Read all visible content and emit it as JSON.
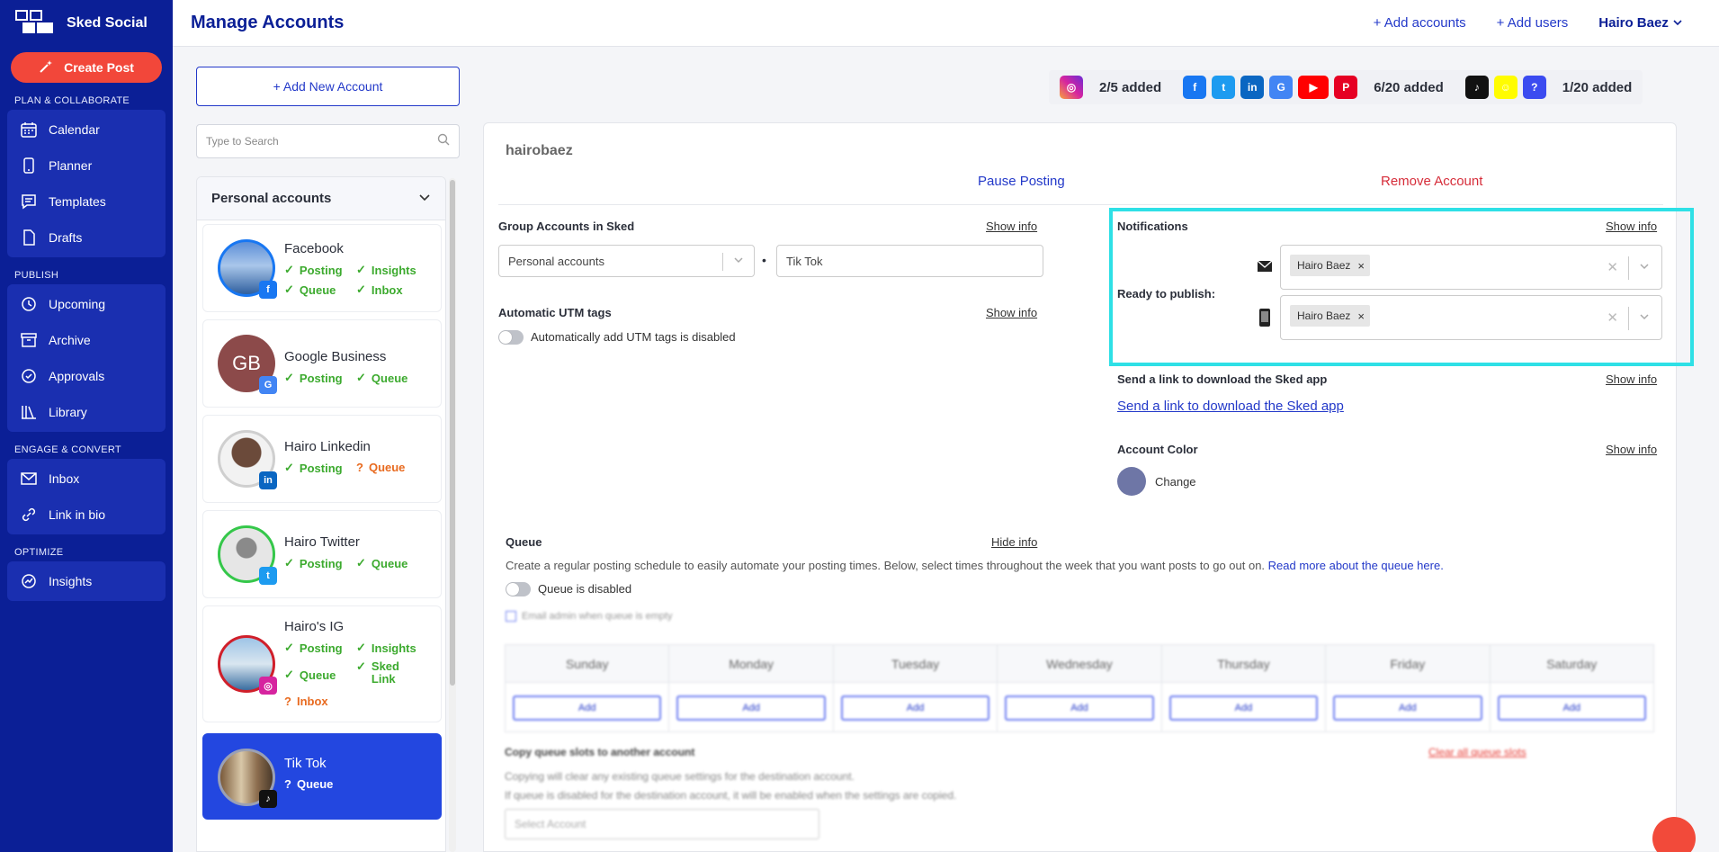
{
  "brand": {
    "name": "Sked Social",
    "logo_text": "SOCIAL"
  },
  "sidebar": {
    "create_post": "Create Post",
    "sections": [
      {
        "title": "PLAN & COLLABORATE",
        "items": [
          "Calendar",
          "Planner",
          "Templates",
          "Drafts"
        ]
      },
      {
        "title": "PUBLISH",
        "items": [
          "Upcoming",
          "Archive",
          "Approvals",
          "Library"
        ]
      },
      {
        "title": "ENGAGE & CONVERT",
        "items": [
          "Inbox",
          "Link in bio"
        ]
      },
      {
        "title": "OPTIMIZE",
        "items": [
          "Insights"
        ]
      }
    ]
  },
  "topbar": {
    "title": "Manage Accounts",
    "add_accounts": "+ Add accounts",
    "add_users": "+ Add users",
    "user": "Hairo Baez"
  },
  "left": {
    "add_new": "+ Add New Account",
    "search_placeholder": "Type to Search",
    "group": "Personal accounts",
    "accounts": [
      {
        "name": "Facebook",
        "features": [
          "Posting",
          "Insights",
          "Queue",
          "Inbox"
        ]
      },
      {
        "name": "Google Business",
        "initials": "GB",
        "features": [
          "Posting",
          "Queue"
        ]
      },
      {
        "name": "Hairo Linkedin",
        "features": [
          "Posting",
          "Queue"
        ]
      },
      {
        "name": "Hairo Twitter",
        "features": [
          "Posting",
          "Queue"
        ]
      },
      {
        "name": "Hairo's IG",
        "features": [
          "Posting",
          "Insights",
          "Queue",
          "Sked Link",
          "Inbox"
        ]
      },
      {
        "name": "Tik Tok",
        "features": [
          "Queue"
        ]
      }
    ]
  },
  "platform_counts": [
    "2/5 added",
    "6/20 added",
    "1/20 added"
  ],
  "detail": {
    "username": "hairobaez",
    "pause": "Pause Posting",
    "remove": "Remove Account",
    "show_info": "Show info",
    "hide_info": "Hide info",
    "group_label": "Group Accounts in Sked",
    "group_value": "Personal accounts",
    "group_name": "Tik Tok",
    "utm_label": "Automatic UTM tags",
    "utm_toggle": "Automatically add UTM tags is disabled",
    "notifications_label": "Notifications",
    "ready_label": "Ready to publish:",
    "notify_user": "Hairo Baez",
    "app_label": "Send a link to download the Sked app",
    "app_link": "Send a link to download the Sked app",
    "color_label": "Account Color",
    "color_change": "Change",
    "queue_label": "Queue",
    "queue_desc": "Create a regular posting schedule to easily automate your posting times. Below, select times throughout the week that you want posts to go out on.",
    "queue_read_more": "Read more about the queue here.",
    "queue_toggle": "Queue is disabled",
    "email_admin": "Email admin when queue is empty",
    "days": [
      "Sunday",
      "Monday",
      "Tuesday",
      "Wednesday",
      "Thursday",
      "Friday",
      "Saturday"
    ],
    "add": "Add",
    "copy_title": "Copy queue slots to another account",
    "clear_all": "Clear all queue slots",
    "copy_desc_1": "Copying will clear any existing queue settings for the destination account.",
    "copy_desc_2": "If queue is disabled for the destination account, it will be enabled when the settings are copied.",
    "select_account": "Select Account"
  },
  "colors": {
    "sidebar": "#0b1f96",
    "accent": "#2339c9",
    "create": "#f2473a",
    "ok": "#3caa2e",
    "warn": "#e86a1f",
    "highlight": "#2ee0e6"
  }
}
